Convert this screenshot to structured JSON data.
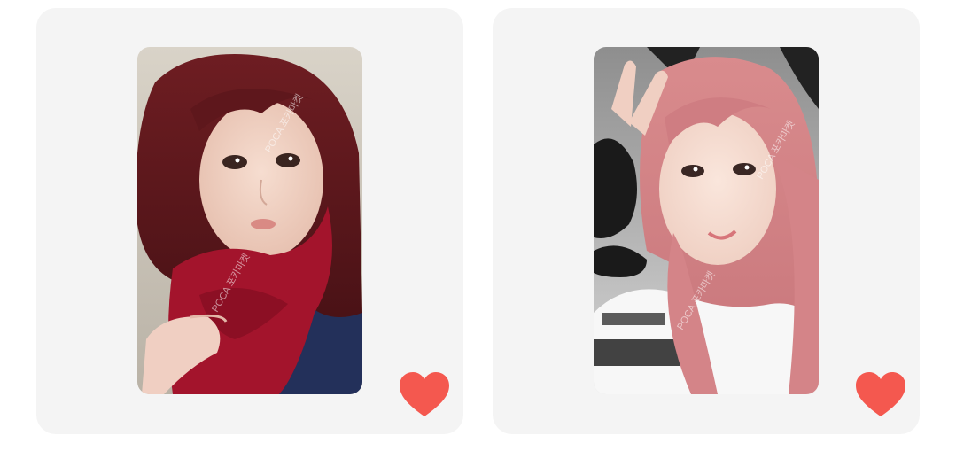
{
  "colors": {
    "card_background": "#f4f4f4",
    "heart": "#f4584f",
    "page_background": "#ffffff"
  },
  "cards": [
    {
      "photo_alt": "Photo card: woman with dark red hair wearing a red knit scarf",
      "watermark": "POCA 포카마켓",
      "liked": true,
      "like_icon": "heart-icon"
    },
    {
      "photo_alt": "Photo card: woman with pink hair making a peace sign in fingerless black gloves",
      "watermark": "POCA 포카마켓",
      "liked": true,
      "like_icon": "heart-icon"
    }
  ]
}
